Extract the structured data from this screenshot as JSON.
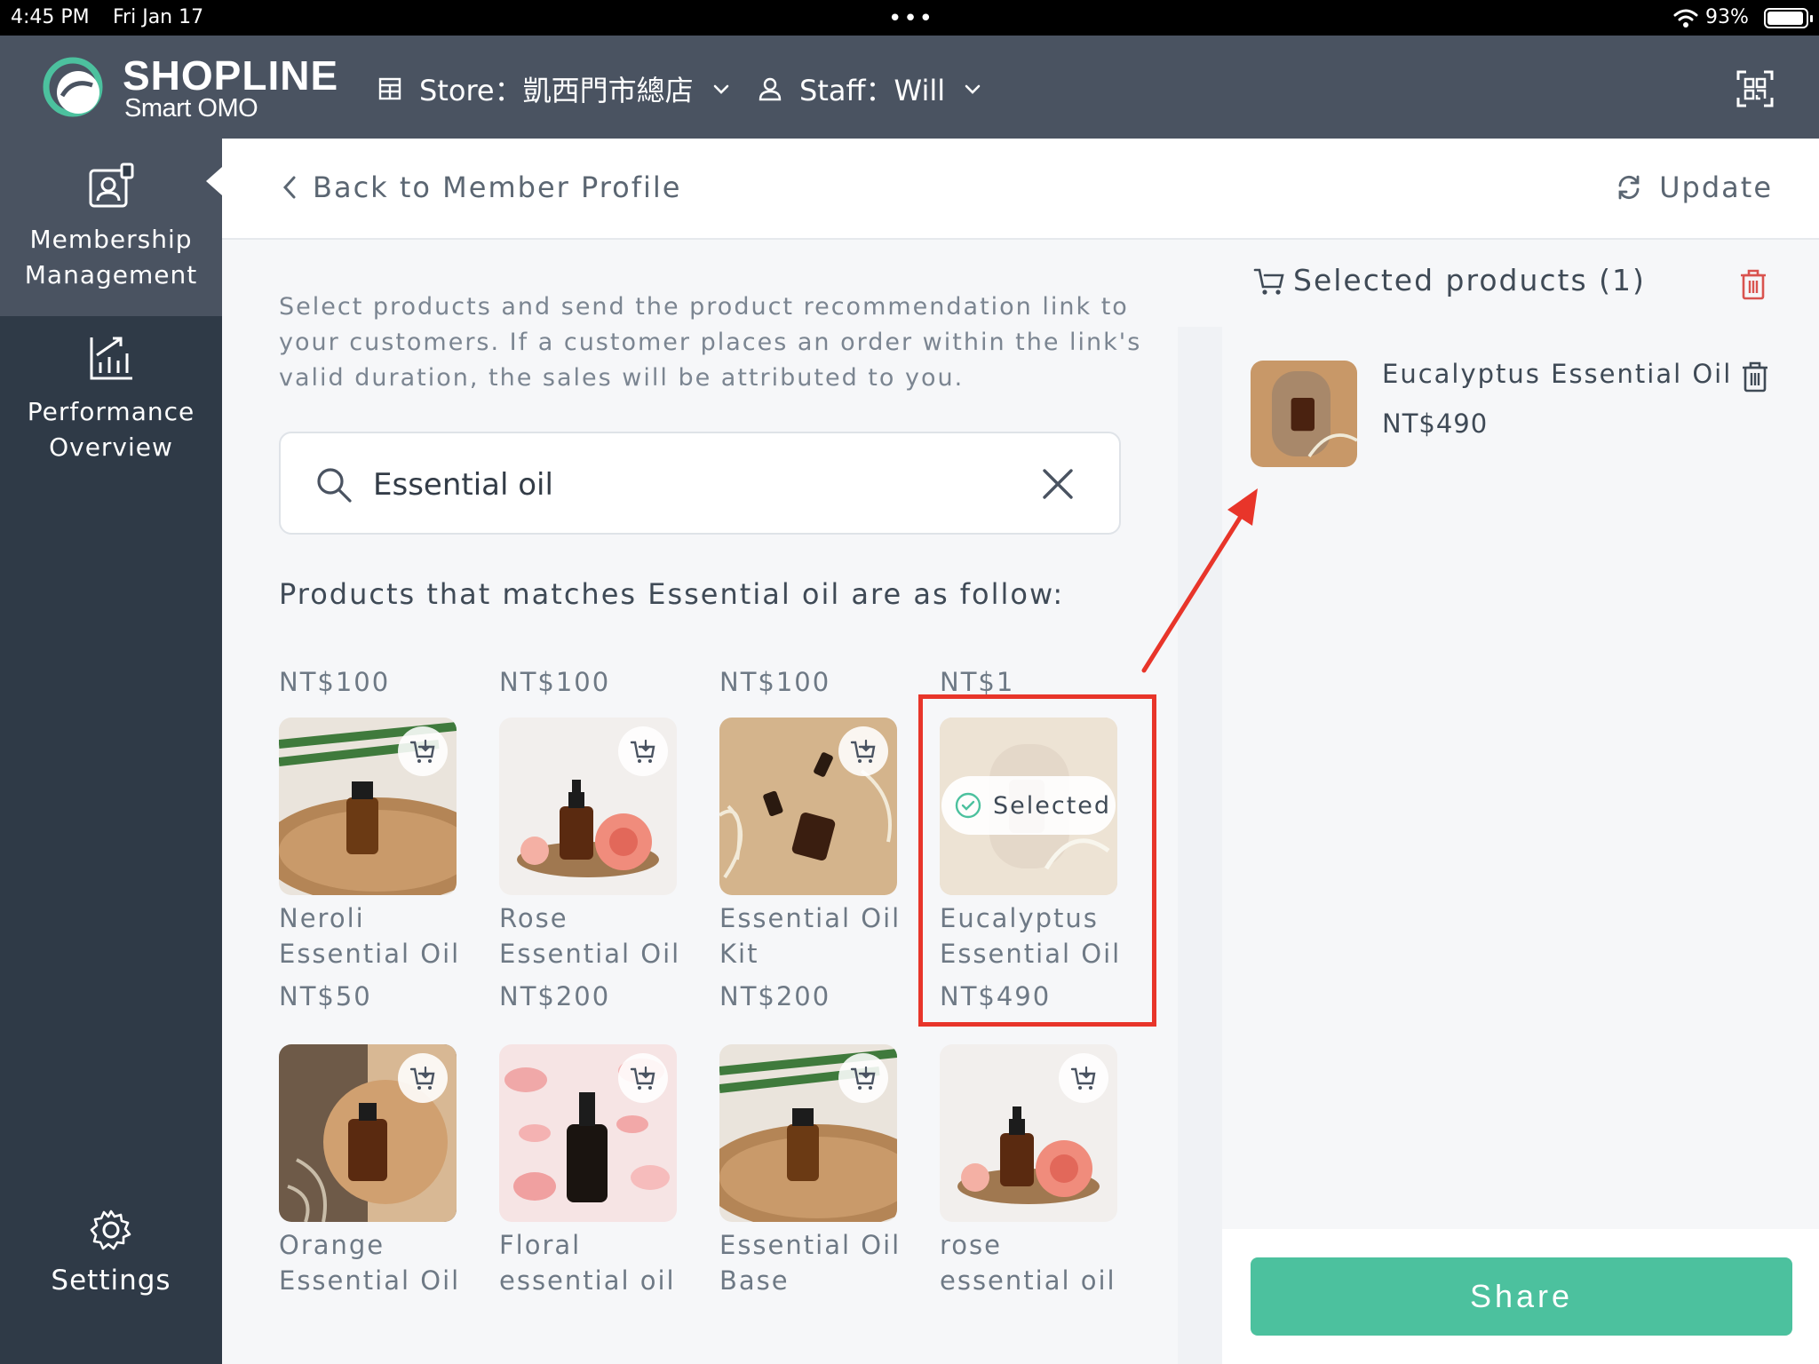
{
  "status_bar": {
    "time": "4:45 PM",
    "date": "Fri Jan 17",
    "battery": "93%"
  },
  "header": {
    "brand": "SHOPLINE",
    "brand_sub": "Smart OMO",
    "store_label": "Store：凱西門市總店",
    "staff_label": "Staff：Will"
  },
  "sidebar": {
    "items": [
      {
        "label_line1": "Membership",
        "label_line2": "Management",
        "icon": "member-card-icon",
        "active": true
      },
      {
        "label_line1": "Performance",
        "label_line2": "Overview",
        "icon": "chart-icon",
        "active": false
      }
    ],
    "settings_label": "Settings"
  },
  "main": {
    "back_label": "Back to Member Profile",
    "update_label": "Update",
    "intro_text": "Select products and send the product recommendation link to your customers. If a customer places an order within the link's valid duration, the sales will be attributed to you.",
    "search": {
      "value": "Essential oil",
      "placeholder": ""
    },
    "results_heading": "Products that matches Essential oil are as follow:",
    "top_row_prices": [
      "NT$100",
      "NT$100",
      "NT$100",
      "NT$1"
    ],
    "selected_label": "Selected",
    "products": [
      {
        "name_line1": "Neroli",
        "name_line2": "Essential Oil",
        "price": "NT$50",
        "selected": false
      },
      {
        "name_line1": "Rose",
        "name_line2": "Essential Oil",
        "price": "NT$200",
        "selected": false
      },
      {
        "name_line1": "Essential Oil",
        "name_line2": "Kit",
        "price": "NT$200",
        "selected": false
      },
      {
        "name_line1": "Eucalyptus",
        "name_line2": "Essential Oil",
        "price": "NT$490",
        "selected": true
      },
      {
        "name_line1": "Orange",
        "name_line2": "Essential Oil",
        "price": "",
        "selected": false
      },
      {
        "name_line1": "Floral",
        "name_line2": "essential oil",
        "price": "",
        "selected": false
      },
      {
        "name_line1": "Essential Oil",
        "name_line2": "Base",
        "price": "",
        "selected": false
      },
      {
        "name_line1": "rose",
        "name_line2": "essential oil",
        "price": "",
        "selected": false
      }
    ]
  },
  "selected_panel": {
    "title": "Selected products (1)",
    "items": [
      {
        "name": "Eucalyptus Essential Oil",
        "price": "NT$490"
      }
    ],
    "share_label": "Share"
  },
  "colors": {
    "brand_green": "#4cc19e",
    "header_bg": "#4a5361",
    "sidebar_bg": "#2f3a47",
    "delete_red": "#d9534f",
    "annotation_red": "#e8352a"
  }
}
